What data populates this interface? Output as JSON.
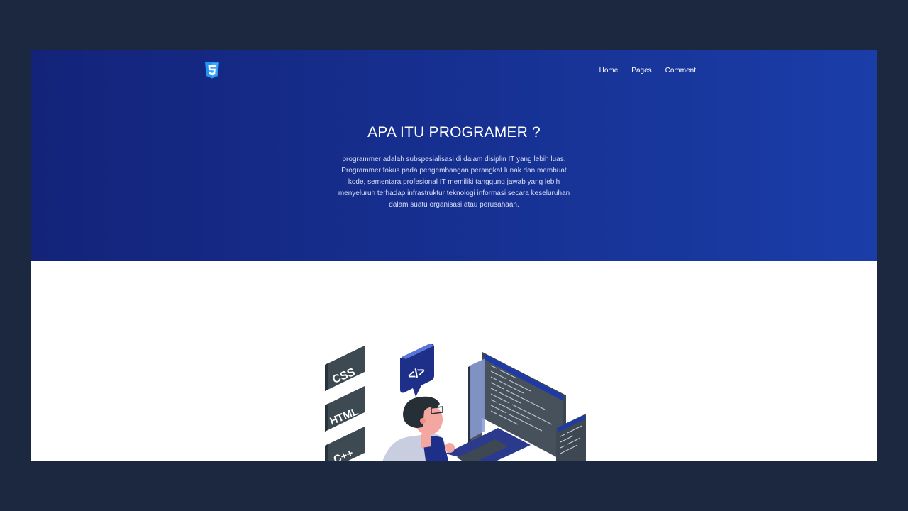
{
  "nav": {
    "logo_icon": "html5-shield-icon",
    "items": [
      {
        "label": "Home"
      },
      {
        "label": "Pages"
      },
      {
        "label": "Comment"
      }
    ]
  },
  "hero": {
    "title": "APA ITU PROGRAMER ?",
    "description": "programmer adalah subspesialisasi di dalam disiplin IT yang lebih luas. Programmer fokus pada pengembangan perangkat lunak dan membuat kode, sementara profesional IT memiliki tanggung jawab yang lebih menyeluruh terhadap infrastruktur teknologi informasi secara keseluruhan dalam suatu organisasi atau perusahaan.",
    "colors": {
      "gradient_start": "#13237a",
      "gradient_end": "#1a3da8"
    }
  },
  "illustration": {
    "badges": [
      "CSS",
      "HTML",
      "C++"
    ],
    "code_bubble": "</>"
  }
}
